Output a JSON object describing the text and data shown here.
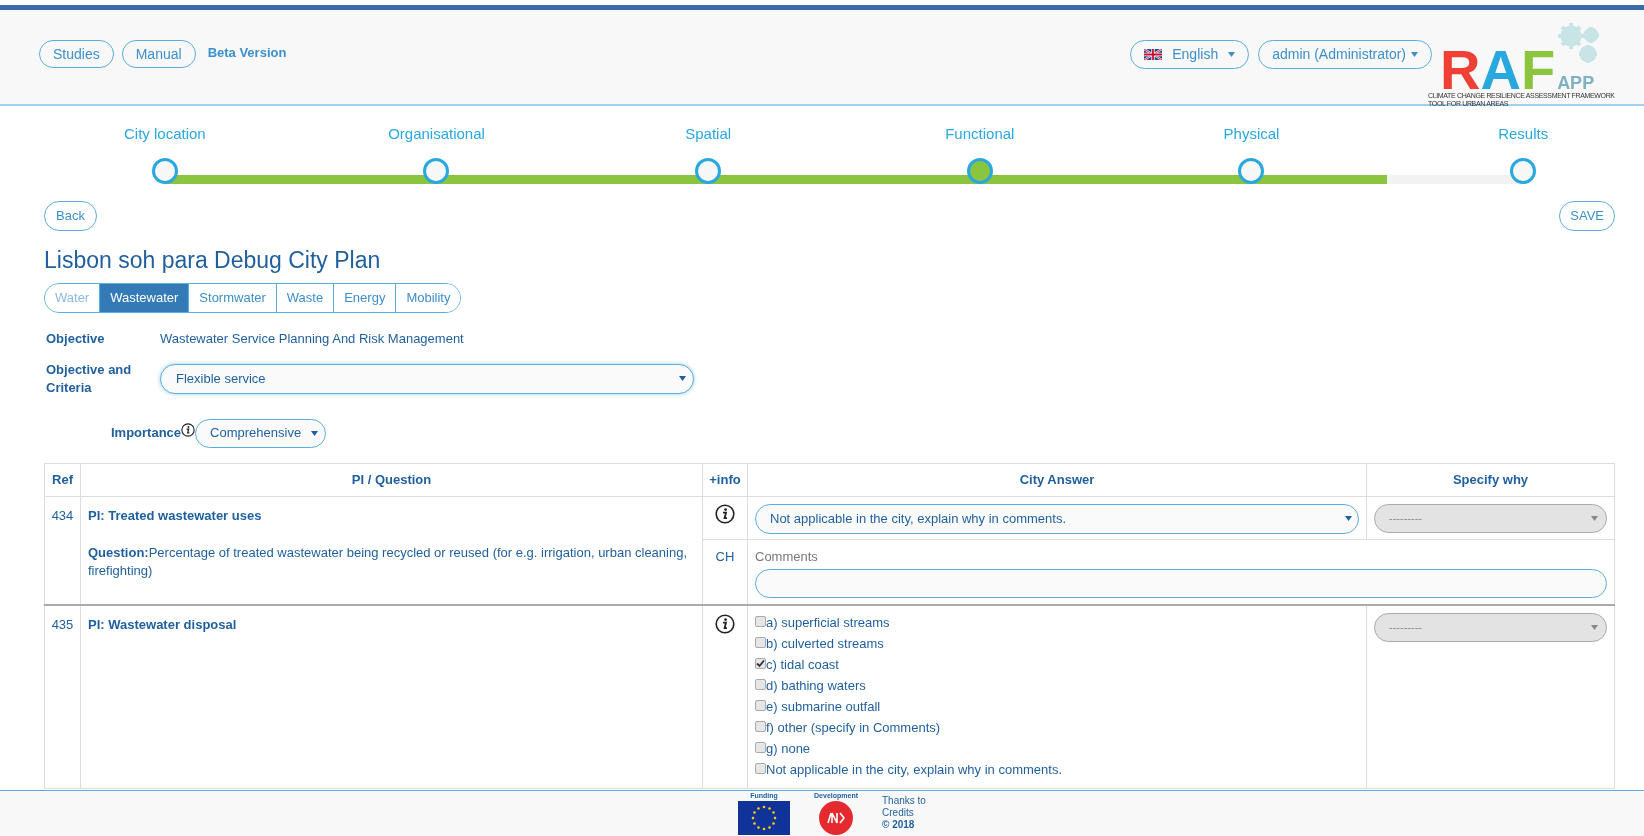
{
  "header": {
    "buttons": [
      "Studies",
      "Manual"
    ],
    "beta_label": "Beta Version",
    "language": "English",
    "user": "admin (Administrator)",
    "logo": {
      "letters": [
        "R",
        "A",
        "F"
      ],
      "suffix": "APP",
      "tagline": [
        "CLIMATE CHANGE RESILIENCE ASSESSMENT FRAMEWORK",
        "TOOL FOR URBAN AREAS"
      ]
    }
  },
  "stepper": {
    "level": 0.9,
    "steps": [
      {
        "label": "City location",
        "selected": false
      },
      {
        "label": "Organisational",
        "selected": false
      },
      {
        "label": "Spatial",
        "selected": false
      },
      {
        "label": "Functional",
        "selected": true
      },
      {
        "label": "Physical",
        "selected": false
      },
      {
        "label": "Results",
        "selected": false
      }
    ]
  },
  "back_button": "Back",
  "save_button": "SAVE",
  "title": "Lisbon soh para Debug City Plan",
  "tabs": [
    {
      "label": "Water",
      "selected": false,
      "disabled": true
    },
    {
      "label": "Wastewater",
      "selected": true,
      "disabled": false
    },
    {
      "label": "Stormwater",
      "selected": false,
      "disabled": false
    },
    {
      "label": "Waste",
      "selected": false,
      "disabled": false
    },
    {
      "label": "Energy",
      "selected": false,
      "disabled": false
    },
    {
      "label": "Mobility",
      "selected": false,
      "disabled": false
    }
  ],
  "objective": {
    "label": "Objective",
    "value": "Wastewater Service Planning And Risk Management"
  },
  "criteria": {
    "label": "Objective and Criteria",
    "value": "Flexible service"
  },
  "importance": {
    "label": "Importance",
    "value": "Comprehensive"
  },
  "table": {
    "columns": [
      "Ref",
      "PI / Question",
      "+info",
      "City Answer",
      "Specify why"
    ],
    "rows": [
      {
        "ref": "434",
        "pi": "PI: Treated wastewater uses",
        "question": "**Question:**Percentage of treated wastewater being recycled or reused (for e.g. irrigation, urban cleaning, firefighting)",
        "answer": {
          "kind": "select",
          "value": "Not applicable in the city, explain why in comments."
        },
        "specify": "---------",
        "code": "CH",
        "comments_label": "Comments"
      },
      {
        "ref": "435",
        "pi": "PI: Wastewater disposal",
        "answer": {
          "kind": "checklist",
          "options": [
            {
              "label": "a) superficial streams",
              "checked": false
            },
            {
              "label": "b) culverted streams",
              "checked": false
            },
            {
              "label": "c) tidal coast",
              "checked": true
            },
            {
              "label": "d) bathing waters",
              "checked": false
            },
            {
              "label": "e) submarine outfall",
              "checked": false
            },
            {
              "label": "f) other (specify in Comments)",
              "checked": false
            },
            {
              "label": "g) none",
              "checked": false
            },
            {
              "label": "Not applicable in the city, explain why in comments.",
              "checked": false
            }
          ]
        },
        "specify": "---------"
      }
    ]
  },
  "footer": {
    "funding_label": "Funding",
    "development_label": "Development",
    "thanks": "Thanks to",
    "credits": "Credits",
    "copyright": "© 2018"
  }
}
